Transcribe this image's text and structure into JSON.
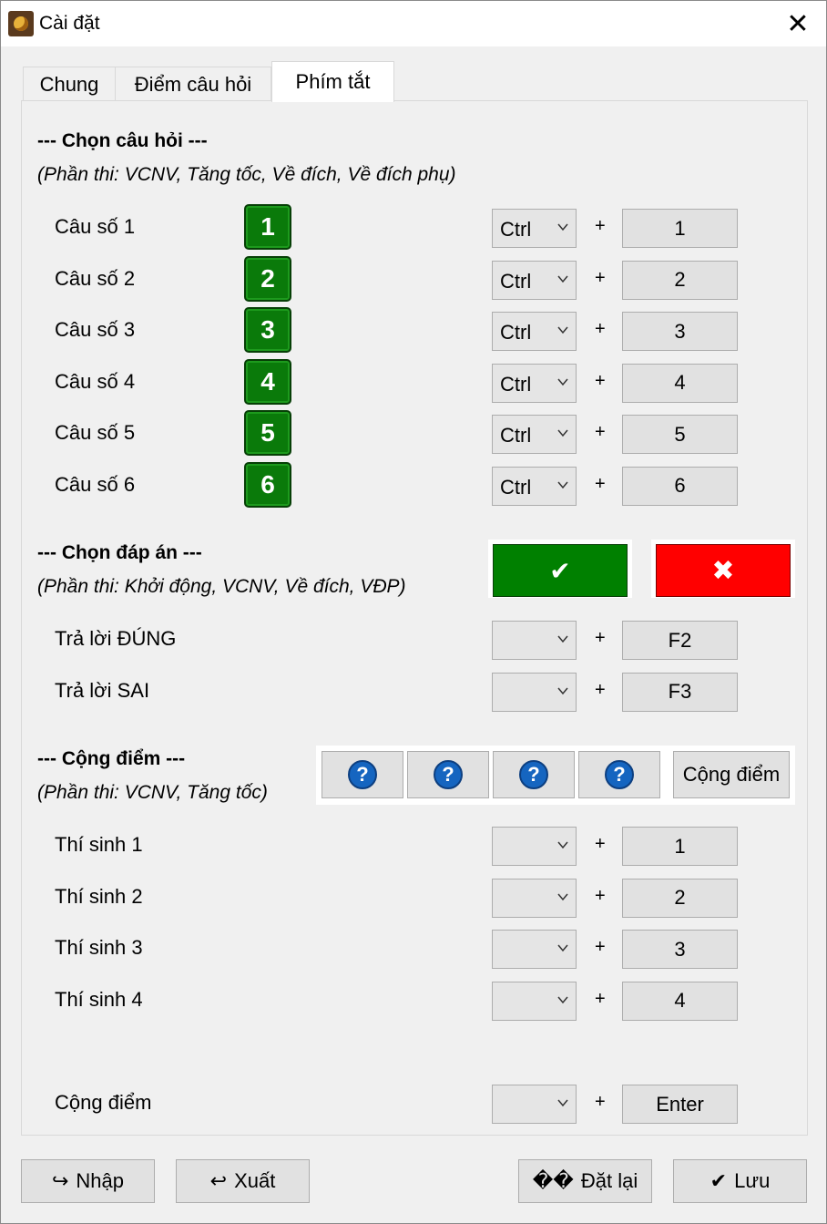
{
  "window": {
    "title": "Cài đặt",
    "close_glyph": "✕"
  },
  "tabs": [
    {
      "label": "Chung",
      "active": false
    },
    {
      "label": "Điểm câu hỏi",
      "active": false
    },
    {
      "label": "Phím tắt",
      "active": true
    }
  ],
  "section_questions": {
    "title": "--- Chọn câu hỏi ---",
    "subtitle": "(Phần thi: VCNV, Tăng tốc, Về đích, Về đích phụ)",
    "rows": [
      {
        "label": "Câu số 1",
        "badge": "1",
        "modifier": "Ctrl",
        "key": "1"
      },
      {
        "label": "Câu số 2",
        "badge": "2",
        "modifier": "Ctrl",
        "key": "2"
      },
      {
        "label": "Câu số 3",
        "badge": "3",
        "modifier": "Ctrl",
        "key": "3"
      },
      {
        "label": "Câu số 4",
        "badge": "4",
        "modifier": "Ctrl",
        "key": "4"
      },
      {
        "label": "Câu số 5",
        "badge": "5",
        "modifier": "Ctrl",
        "key": "5"
      },
      {
        "label": "Câu số 6",
        "badge": "6",
        "modifier": "Ctrl",
        "key": "6"
      }
    ]
  },
  "section_answers": {
    "title": "--- Chọn đáp án ---",
    "subtitle": "(Phần thi: Khởi động, VCNV, Về đích, VĐP)",
    "correct_glyph": "✔",
    "wrong_glyph": "✖",
    "colors": {
      "correct": "#008000",
      "wrong": "#ff0000"
    },
    "rows": [
      {
        "label": "Trả lời ĐÚNG",
        "modifier": "",
        "key": "F2"
      },
      {
        "label": "Trả lời SAI",
        "modifier": "",
        "key": "F3"
      }
    ]
  },
  "section_points": {
    "title": "--- Cộng điểm ---",
    "subtitle": "(Phần thi: VCNV, Tăng tốc)",
    "question_glyph": "?",
    "add_button": "Cộng điểm",
    "rows": [
      {
        "label": "Thí sinh 1",
        "modifier": "",
        "key": "1"
      },
      {
        "label": "Thí sinh 2",
        "modifier": "",
        "key": "2"
      },
      {
        "label": "Thí sinh 3",
        "modifier": "",
        "key": "3"
      },
      {
        "label": "Thí sinh 4",
        "modifier": "",
        "key": "4"
      }
    ],
    "final_row": {
      "label": "Cộng điểm",
      "modifier": "",
      "key": "Enter"
    }
  },
  "footer": {
    "import": {
      "icon": "↪",
      "label": "Nhập"
    },
    "export": {
      "icon": "↩",
      "label": "Xuất"
    },
    "reset": {
      "icon": "��",
      "label": "Đặt lại"
    },
    "save": {
      "icon": "✔",
      "label": "Lưu"
    }
  }
}
